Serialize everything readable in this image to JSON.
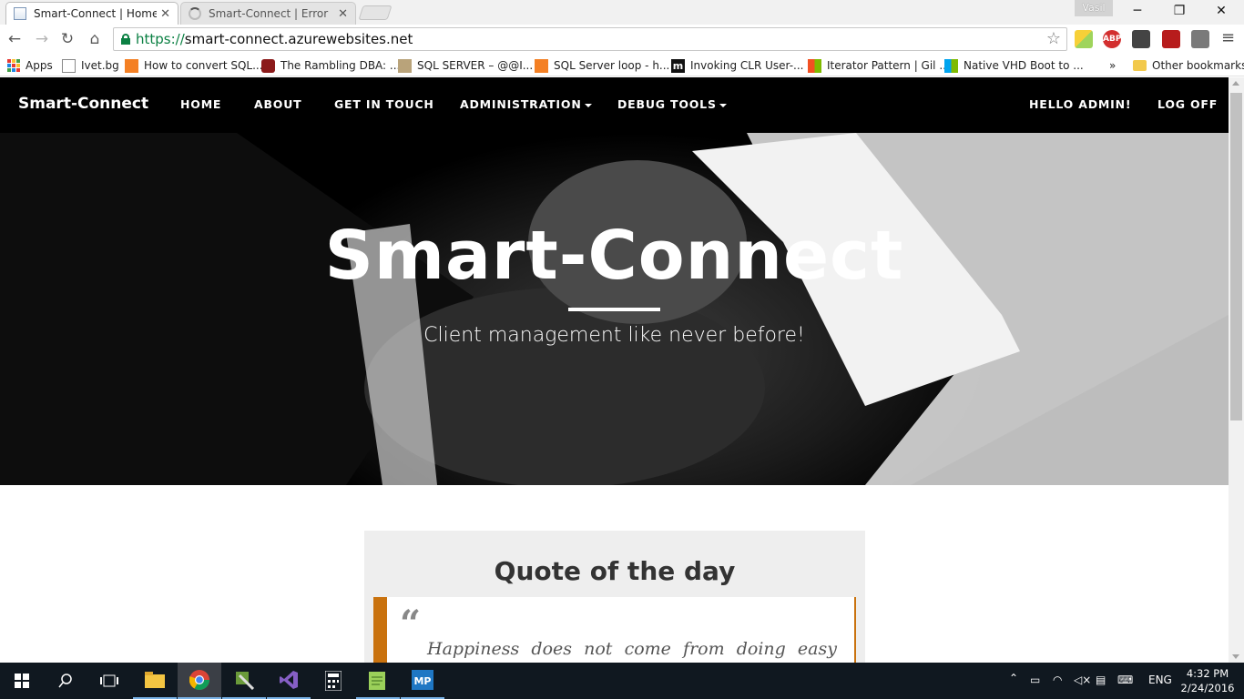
{
  "browser": {
    "tabs": [
      {
        "label": "Smart-Connect | Home",
        "active": true
      },
      {
        "label": "Smart-Connect | Error",
        "active": false
      }
    ],
    "profile_name": "Vasil",
    "url_scheme": "https://",
    "url_host": "smart-connect.azurewebsites.net",
    "bookmarks": [
      "Apps",
      "Ivet.bg",
      "How to convert SQL...",
      "The Rambling DBA: ...",
      "SQL SERVER – @@I...",
      "SQL Server loop - h...",
      "Invoking CLR User-...",
      "Iterator Pattern | Gil ...",
      "Native VHD Boot to ..."
    ],
    "bookmarks_overflow": "»",
    "other_bookmarks": "Other bookmarks",
    "extension_abp": "ABP"
  },
  "site": {
    "brand": "Smart-Connect",
    "nav": {
      "home": "HOME",
      "about": "ABOUT",
      "get_in_touch": "GET IN TOUCH",
      "administration": "ADMINISTRATION",
      "debug_tools": "DEBUG TOOLS",
      "greeting": "HELLO ADMIN!",
      "log_off": "LOG OFF"
    },
    "hero": {
      "title": "Smart-Connect",
      "subtitle": "Client management like never before!"
    },
    "quote": {
      "heading": "Quote of the day",
      "mark": "“",
      "text": "Happiness does not come from doing easy"
    }
  },
  "taskbar": {
    "language": "ENG",
    "time": "4:32 PM",
    "date": "2/24/2016"
  },
  "colors": {
    "nav_bg": "#000000",
    "quote_accent": "#c9720e",
    "url_secure": "#0b8043",
    "taskbar_bg": "#101820"
  }
}
